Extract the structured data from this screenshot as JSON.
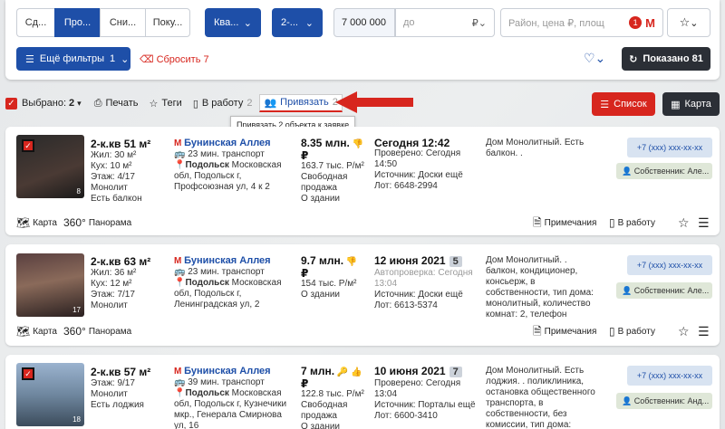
{
  "filters": {
    "segments": [
      {
        "label": "Сд..."
      },
      {
        "label": "Про...",
        "active": true
      },
      {
        "label": "Сни..."
      },
      {
        "label": "Поку..."
      }
    ],
    "type_dd": "Ква...",
    "rooms_dd": "2-...",
    "price_from": "7 000 000",
    "price_to_placeholder": "до",
    "currency": "₽",
    "search_placeholder": "Район, цена ₽, площ",
    "metro_count": "1",
    "more_filters": "Ещё фильтры",
    "more_filters_count": "1",
    "reset": "Сбросить 7",
    "shown": "Показано 81"
  },
  "toolbar": {
    "selected_label": "Выбрано:",
    "selected_count": "2",
    "print": "Печать",
    "tags": "Теги",
    "to_work": "В работу",
    "to_work_count": "2",
    "bind": "Привязать",
    "bind_count": "2",
    "list": "Список",
    "map": "Карта",
    "tooltip": "Привязать 2 объекта к заявке"
  },
  "listings": [
    {
      "title": "2-к.кв 51 м²",
      "details": [
        "Жил: 30 м²",
        "Кух: 10 м²",
        "Этаж: 4/17",
        "Монолит",
        "Есть балкон"
      ],
      "metro": "Бунинская Аллея",
      "transport": "23 мин. транспорт",
      "city": "Подольск",
      "address": "Московская обл, Подольск г, Профсоюзная ул, 4 к 2",
      "price": "8.35 млн.",
      "currency": "₽",
      "price_m2": "163.7 тыс. Р/м²",
      "sale": "Свободная продажа",
      "about": "О здании",
      "date": "Сегодня 12:42",
      "badge": "",
      "checked": "Проверено: Сегодня 14:50",
      "source": "Источник: Доски ещё",
      "lot": "Лот: 6648-2994",
      "desc": "Дом Монолитный. Есть балкон. .",
      "phone": "+7 (xxx) xxx-xx-xx",
      "owner": "Собственник: Але...",
      "photo_count": "8",
      "selected": true,
      "map": "Карта",
      "pano": "Панорама",
      "notes": "Примечания",
      "work": "В работу"
    },
    {
      "title": "2-к.кв 63 м²",
      "details": [
        "Жил: 36 м²",
        "Кух: 12 м²",
        "Этаж: 7/17",
        "Монолит"
      ],
      "metro": "Бунинская Аллея",
      "transport": "23 мин. транспорт",
      "city": "Подольск",
      "address": "Московская обл, Подольск г, Ленинградская ул, 2",
      "price": "9.7 млн.",
      "currency": "₽",
      "price_m2": "154 тыс. Р/м²",
      "sale": "О здании",
      "about": "",
      "date": "12 июня 2021",
      "badge": "5",
      "checked": "Автопроверка: Сегодня 13:04",
      "source": "Источник: Доски ещё",
      "lot": "Лот: 6613-5374",
      "desc": "Дом Монолитный. . балкон, кондиционер, консьерж, в собственности, тип дома: монолитный, количество комнат: 2, телефон",
      "phone": "+7 (xxx) xxx-xx-xx",
      "owner": "Собственник: Але...",
      "photo_count": "17",
      "selected": false,
      "map": "Карта",
      "pano": "Панорама",
      "notes": "Примечания",
      "work": "В работу"
    },
    {
      "title": "2-к.кв 57 м²",
      "details": [
        "Этаж: 9/17",
        "Монолит",
        "Есть лоджия"
      ],
      "metro": "Бунинская Аллея",
      "transport": "39 мин. транспорт",
      "city": "Подольск",
      "address": "Московская обл, Подольск г, Кузнечики мкр., Генерала Смирнова ул, 16",
      "price": "7 млн.",
      "currency": "₽",
      "price_m2": "122.8 тыс. Р/м²",
      "sale": "Свободная продажа",
      "about": "О здании",
      "date": "10 июня 2021",
      "badge": "7",
      "checked": "Проверено: Сегодня 13:04",
      "source": "Источник: Порталы ещё",
      "lot": "Лот: 6600-3410",
      "desc": "Дом Монолитный. Есть лоджия. . поликлиника, остановка общественного транспорта, в собственности, без комиссии, тип дома: монолитный, количество",
      "phone": "+7 (xxx) xxx-xx-xx",
      "owner": "Собственник: Анд...",
      "photo_count": "18",
      "selected": true,
      "map": "",
      "pano": "",
      "notes": "",
      "work": ""
    }
  ]
}
